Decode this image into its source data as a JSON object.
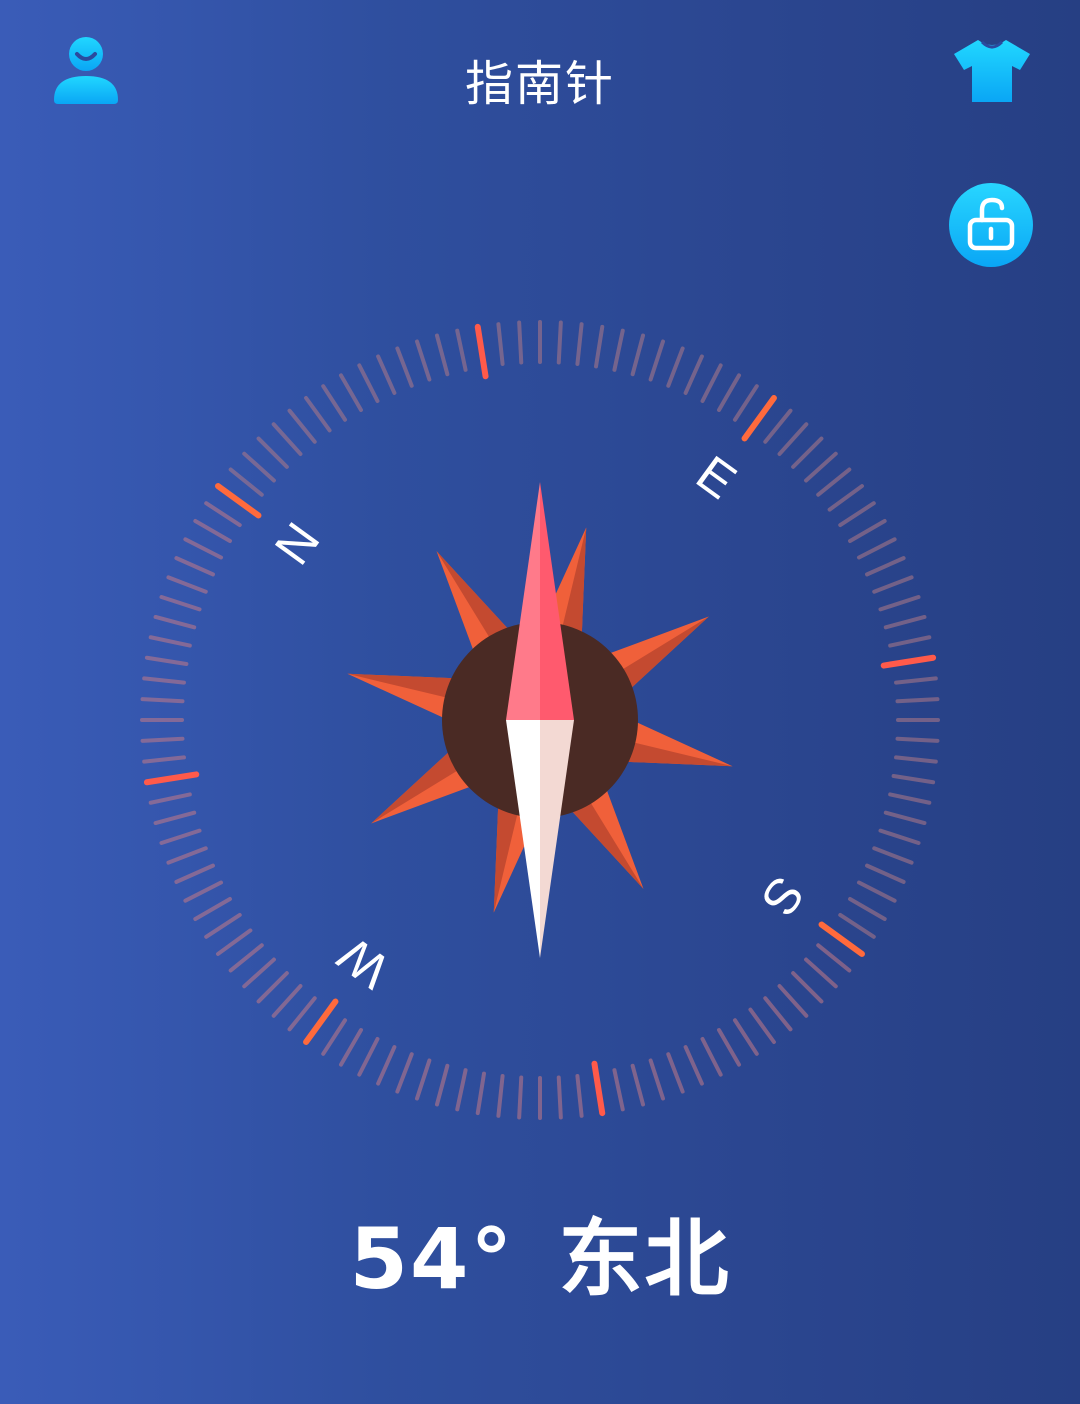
{
  "header": {
    "title": "指南针",
    "profile_icon": "user-profile-icon",
    "theme_icon": "tshirt-icon",
    "lock_icon": "unlock-icon",
    "icon_color": "#18c6ff"
  },
  "compass": {
    "heading_deg": 54,
    "cardinals": [
      "N",
      "E",
      "S",
      "W"
    ],
    "needle_north_color": "#ff5a6e",
    "needle_south_color": "#ffffff",
    "hub_color": "#4a2a24",
    "star_color": "#f0603a"
  },
  "reading": {
    "degrees": "54°",
    "direction": "东北"
  }
}
